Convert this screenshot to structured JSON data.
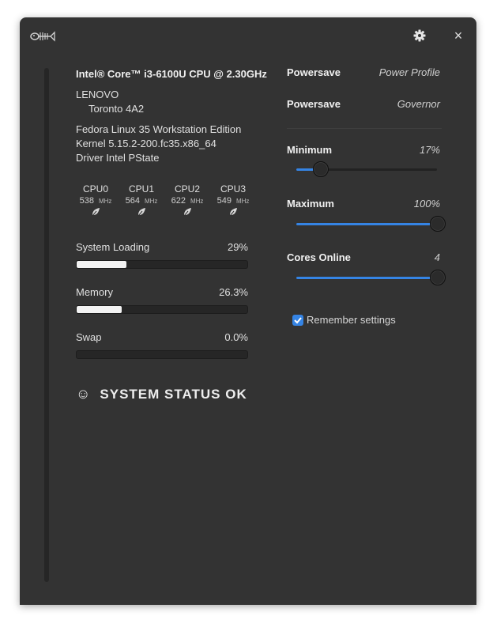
{
  "header": {
    "logo_icon": "fish-logo-icon",
    "settings_icon": "gear-icon",
    "close_glyph": "×"
  },
  "system": {
    "cpu_model": "Intel® Core™ i3-6100U CPU @ 2.30GHz",
    "vendor": "LENOVO",
    "model": "Toronto 4A2",
    "os": "Fedora Linux 35 Workstation Edition",
    "kernel": "Kernel 5.15.2-200.fc35.x86_64",
    "driver": "Driver Intel PState"
  },
  "cpus": [
    {
      "name": "CPU0",
      "freq": "538",
      "unit": "MHz",
      "icon": "leaf-icon"
    },
    {
      "name": "CPU1",
      "freq": "564",
      "unit": "MHz",
      "icon": "leaf-icon"
    },
    {
      "name": "CPU2",
      "freq": "622",
      "unit": "MHz",
      "icon": "leaf-icon"
    },
    {
      "name": "CPU3",
      "freq": "549",
      "unit": "MHz",
      "icon": "leaf-icon"
    }
  ],
  "meters": {
    "loading": {
      "label": "System Loading",
      "value": "29%",
      "fraction": 0.29
    },
    "memory": {
      "label": "Memory",
      "value": "26.3%",
      "fraction": 0.263
    },
    "swap": {
      "label": "Swap",
      "value": "0.0%",
      "fraction": 0.0
    }
  },
  "status": {
    "icon": "☺",
    "text": "SYSTEM STATUS OK"
  },
  "profile": {
    "power_profile_value": "Powersave",
    "power_profile_label": "Power Profile",
    "governor_value": "Powersave",
    "governor_label": "Governor"
  },
  "controls": {
    "minimum": {
      "label": "Minimum",
      "value": "17%",
      "fraction": 0.17
    },
    "maximum": {
      "label": "Maximum",
      "value": "100%",
      "fraction": 1.0
    },
    "cores": {
      "label": "Cores Online",
      "value": "4",
      "fraction": 1.0
    }
  },
  "remember": {
    "label": "Remember settings",
    "checked": true
  },
  "colors": {
    "accent": "#3584e4",
    "background": "#333333"
  }
}
